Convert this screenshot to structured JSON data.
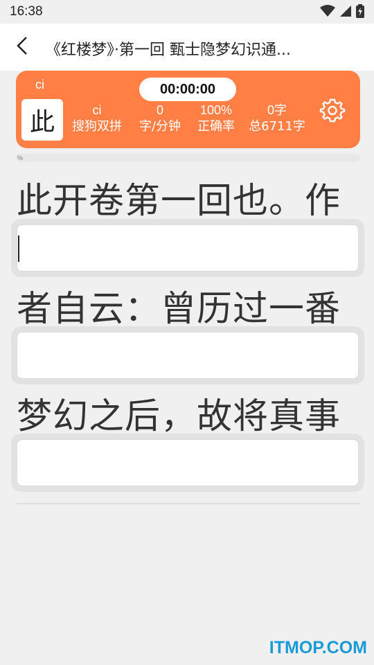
{
  "status_bar": {
    "time": "16:38",
    "icons": [
      "wifi-icon",
      "signal-icon",
      "battery-icon"
    ]
  },
  "app_bar": {
    "back_icon": "chevron-left-icon",
    "title": "《红楼梦》·第一回 甄士隐梦幻识通..."
  },
  "stats": {
    "current_char": "此",
    "current_pinyin": "ci",
    "timer": "00:00:00",
    "scheme_code": "ci",
    "scheme_label": "搜狗双拼",
    "speed_value": "0",
    "speed_label": "字/分钟",
    "accuracy_value": "100%",
    "accuracy_label": "正确率",
    "typed_value": "0字",
    "total_label": "总6711字",
    "settings_icon": "gear-icon"
  },
  "progress": {
    "label": "%",
    "fraction": 0
  },
  "lines": [
    {
      "text": "此开卷第一回也。作",
      "input_value": ""
    },
    {
      "text": "者自云：曾历过一番",
      "input_value": ""
    },
    {
      "text": "梦幻之后，故将真事",
      "input_value": ""
    }
  ],
  "watermark": "ITMOP.COM",
  "colors": {
    "accent": "#ff7f45",
    "background": "#f0f0f0",
    "watermark": "#1a9ad6"
  }
}
